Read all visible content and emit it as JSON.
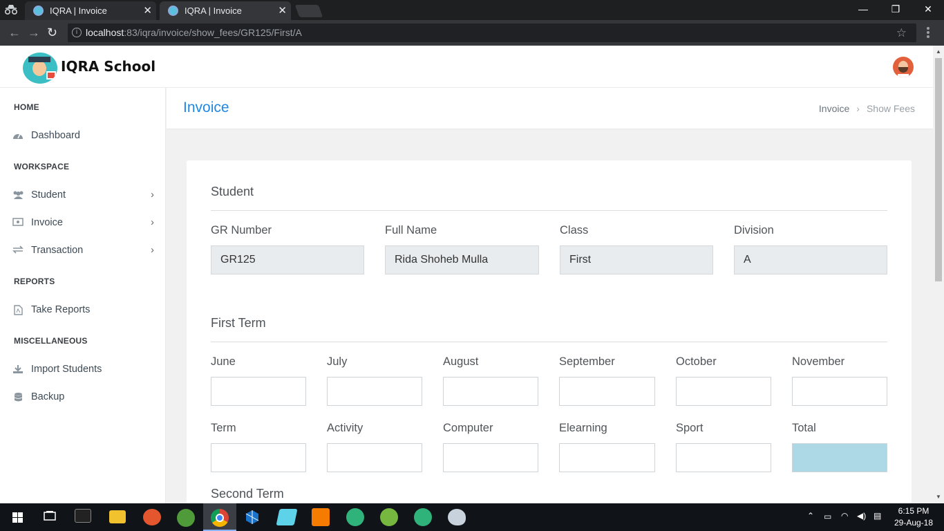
{
  "browser": {
    "tabs": [
      {
        "title": "IQRA | Invoice",
        "close": "✕"
      },
      {
        "title": "IQRA | Invoice",
        "close": "✕"
      }
    ],
    "url_host": "localhost",
    "url_path": ":83/iqra/invoice/show_fees/GR125/First/A",
    "window_controls": {
      "minimize": "—",
      "restore": "❐",
      "close": "✕"
    }
  },
  "app": {
    "brand": "IQRA School"
  },
  "sidebar": {
    "sections": [
      {
        "title": "HOME",
        "items": [
          {
            "label": "Dashboard",
            "icon": "dashboard-icon",
            "has_children": false
          }
        ]
      },
      {
        "title": "WORKSPACE",
        "items": [
          {
            "label": "Student",
            "icon": "users-icon",
            "has_children": true
          },
          {
            "label": "Invoice",
            "icon": "invoice-icon",
            "has_children": true
          },
          {
            "label": "Transaction",
            "icon": "exchange-icon",
            "has_children": true
          }
        ]
      },
      {
        "title": "REPORTS",
        "items": [
          {
            "label": "Take Reports",
            "icon": "pdf-file-icon",
            "has_children": false
          }
        ]
      },
      {
        "title": "MISCELLANEOUS",
        "items": [
          {
            "label": "Import Students",
            "icon": "download-icon",
            "has_children": false
          },
          {
            "label": "Backup",
            "icon": "database-icon",
            "has_children": false
          }
        ]
      }
    ]
  },
  "page": {
    "title": "Invoice",
    "breadcrumb": [
      "Invoice",
      "Show Fees"
    ]
  },
  "student_section": {
    "title": "Student",
    "fields": [
      {
        "label": "GR Number",
        "value": "GR125"
      },
      {
        "label": "Full Name",
        "value": "Rida Shoheb Mulla"
      },
      {
        "label": "Class",
        "value": "First"
      },
      {
        "label": "Division",
        "value": "A"
      }
    ]
  },
  "first_term": {
    "title": "First Term",
    "months": [
      "June",
      "July",
      "August",
      "September",
      "October",
      "November"
    ],
    "fees": [
      "Term",
      "Activity",
      "Computer",
      "Elearning",
      "Sport",
      "Total"
    ]
  },
  "second_term": {
    "title": "Second Term"
  },
  "taskbar": {
    "time": "6:15 PM",
    "date": "29-Aug-18"
  },
  "colors": {
    "accent": "#1e88e5",
    "total_field": "#add8e6",
    "readonly_field": "#e9ecef"
  }
}
